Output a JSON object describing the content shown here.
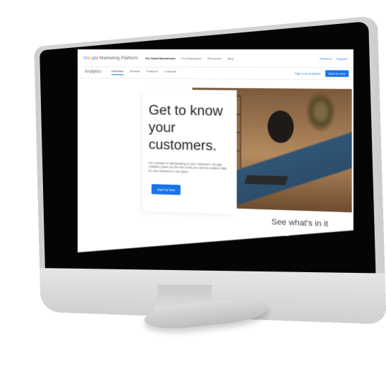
{
  "brand": {
    "google_letters": [
      "G",
      "o",
      "o",
      "g",
      "l",
      "e"
    ],
    "platform": "Marketing Platform"
  },
  "top_nav": {
    "links": [
      "For Small Businesses",
      "For Enterprises",
      "Resources",
      "Blog"
    ],
    "right_links": [
      "Partners",
      "Support"
    ]
  },
  "sub_nav": {
    "product": "Analytics",
    "tabs": [
      "Overview",
      "Benefits",
      "Features",
      "Compare"
    ],
    "sign_in": "Sign in to Analytics",
    "start_button": "Start for free"
  },
  "hero": {
    "title": "Get to know your customers.",
    "body": "Get a deeper understanding of your customers. Google Analytics gives you the free tools you need to analyze data for your business in one place.",
    "cta": "Start for free"
  },
  "section": {
    "heading": "See what's in it"
  },
  "colors": {
    "accent": "#1a73e8",
    "google_blue": "#4285f4",
    "google_red": "#ea4335",
    "google_yellow": "#fbbc05",
    "google_green": "#34a853",
    "monitor_silver": "#d2d3d5",
    "bezel": "#050505"
  }
}
